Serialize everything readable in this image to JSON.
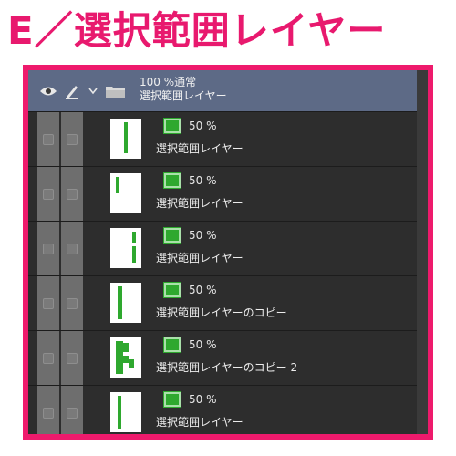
{
  "headline": "E／選択範囲レイヤー",
  "colors": {
    "accent": "#ee1a6c",
    "folder_row": "#5d6a86",
    "layer_row": "#2d2d2d",
    "mask_green": "#2ea82e"
  },
  "folder": {
    "blend": "100 %通常",
    "name": "選択範囲レイヤー",
    "icons": [
      "eye-icon",
      "pen-icon",
      "chevron-down-icon",
      "folder-icon"
    ]
  },
  "layers": [
    {
      "opacity": "50 %",
      "name": "選択範囲レイヤー"
    },
    {
      "opacity": "50 %",
      "name": "選択範囲レイヤー"
    },
    {
      "opacity": "50 %",
      "name": "選択範囲レイヤー"
    },
    {
      "opacity": "50 %",
      "name": "選択範囲レイヤーのコピー"
    },
    {
      "opacity": "50 %",
      "name": "選択範囲レイヤーのコピー 2"
    },
    {
      "opacity": "50 %",
      "name": "選択範囲レイヤー"
    }
  ]
}
